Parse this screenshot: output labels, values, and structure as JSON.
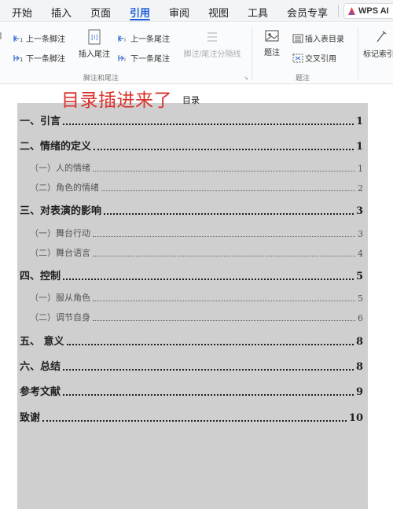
{
  "menu": {
    "items": [
      "开始",
      "插入",
      "页面",
      "引用",
      "审阅",
      "视图",
      "工具",
      "会员专享"
    ],
    "active": "引用",
    "wps_ai": "WPS AI"
  },
  "ribbon": {
    "footnote_group": {
      "prev_footnote": "上一条脚注",
      "next_footnote": "下一条脚注",
      "insert_endnote": "插入尾注",
      "prev_endnote": "上一条尾注",
      "next_endnote": "下一条尾注",
      "separator": "脚注/尾注分隔线",
      "label": "脚注和尾注"
    },
    "caption_group": {
      "caption": "题注",
      "insert_table_of_figures": "插入表目录",
      "cross_reference": "交叉引用",
      "label": "题注"
    },
    "mark_index": "标记索引"
  },
  "document": {
    "annotation": "目录插进来了",
    "toc_title": "目录",
    "toc": [
      {
        "level": 1,
        "text": "一、引言",
        "page": "1"
      },
      {
        "level": 1,
        "text": "二、情绪的定义",
        "page": "1"
      },
      {
        "level": 2,
        "text": "（一）人的情绪",
        "page": "1"
      },
      {
        "level": 2,
        "text": "（二）角色的情绪",
        "page": "2"
      },
      {
        "level": 1,
        "text": "三、对表演的影响",
        "page": "3"
      },
      {
        "level": 2,
        "text": "（一）舞台行动",
        "page": "3"
      },
      {
        "level": 2,
        "text": "（二）舞台语言",
        "page": "4"
      },
      {
        "level": 1,
        "text": "四、控制",
        "page": "5"
      },
      {
        "level": 2,
        "text": "（一）服从角色",
        "page": "5"
      },
      {
        "level": 2,
        "text": "（二）调节自身",
        "page": "6"
      },
      {
        "level": 1,
        "text": "五、 意义",
        "page": "8"
      },
      {
        "level": 1,
        "text": "六、总结",
        "page": "8"
      },
      {
        "level": 1,
        "text": "参考文献",
        "page": "9"
      },
      {
        "level": 1,
        "text": "致谢",
        "page": "10"
      }
    ]
  },
  "colors": {
    "accent": "#1b5fd9",
    "annotation": "#d9302b",
    "toc_highlight": "#cfcfcf"
  }
}
